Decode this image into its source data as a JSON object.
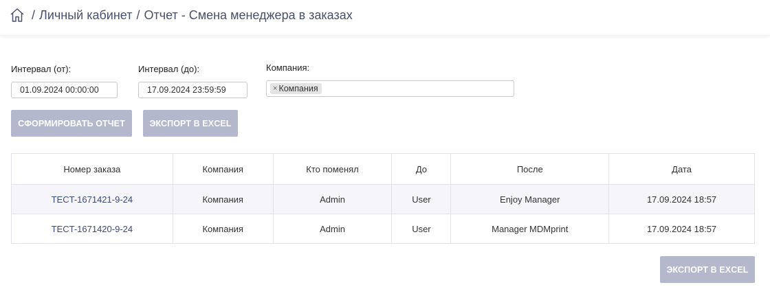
{
  "breadcrumb": {
    "home_icon": "home-icon",
    "items": [
      "Личный кабинет",
      "Отчет - Смена менеджера в заказах"
    ],
    "separator": "/"
  },
  "filters": {
    "from_label": "Интервал (от):",
    "from_value": "01.09.2024 00:00:00",
    "to_label": "Интервал (до):",
    "to_value": "17.09.2024 23:59:59",
    "company_label": "Компания:",
    "company_tag": "Компания",
    "company_tag_remove": "×"
  },
  "actions": {
    "generate_label": "СФОРМИРОВАТЬ ОТЧЕТ",
    "export_label": "ЭКСПОРТ В EXCEL",
    "export_bottom_label": "ЭКСПОРТ В EXCEL",
    "button_color": "#b3b8cd"
  },
  "table": {
    "columns": [
      "Номер заказа",
      "Компания",
      "Кто поменял",
      "До",
      "После",
      "Дата"
    ],
    "rows": [
      [
        "TECT-1671421-9-24",
        "Компания",
        "Admin",
        "User",
        "Enjoy Manager",
        "17.09.2024 18:57"
      ],
      [
        "TECT-1671420-9-24",
        "Компания",
        "Admin",
        "User",
        "Manager MDMprint",
        "17.09.2024 18:57"
      ]
    ]
  }
}
